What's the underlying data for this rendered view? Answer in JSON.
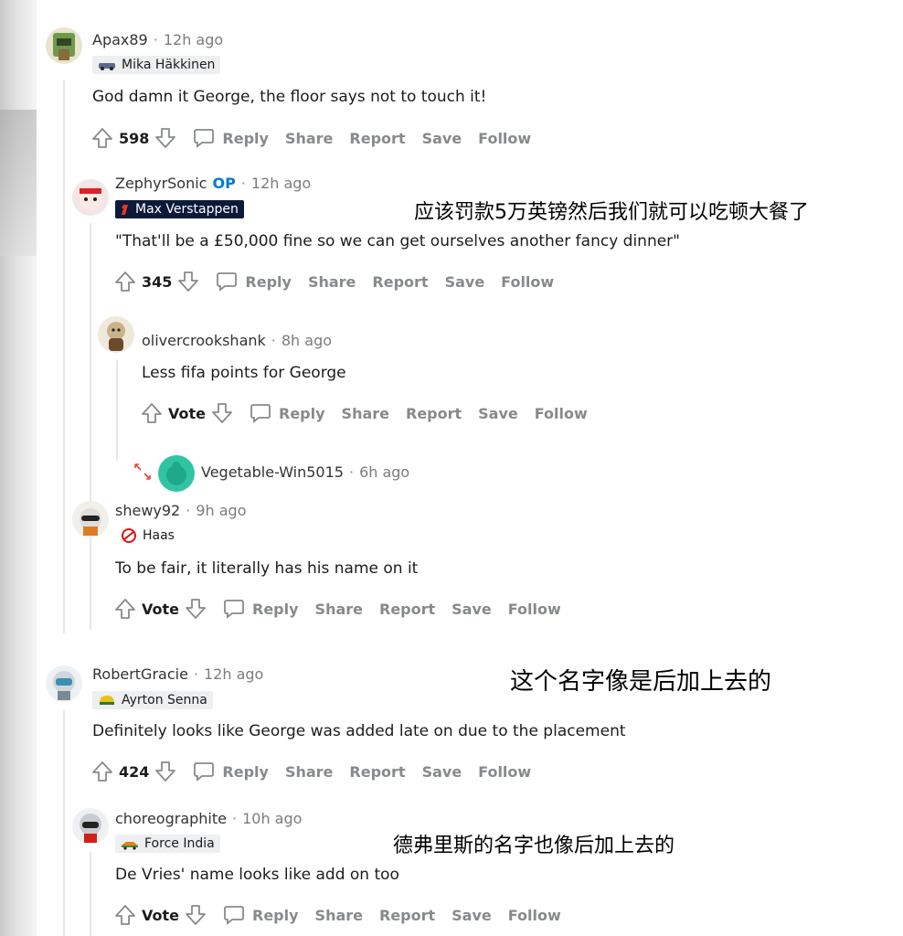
{
  "comments": [
    {
      "username": "Apax89",
      "op": "",
      "time": "12h ago",
      "flair": "Mika Häkkinen",
      "body": "God damn it George, the floor says not to touch it!",
      "score": "598"
    },
    {
      "username": "ZephyrSonic",
      "op": "OP",
      "time": "12h ago",
      "flair": "Max Verstappen",
      "body": "\"That'll be a £50,000 fine so we can get ourselves another fancy dinner\"",
      "score": "345"
    },
    {
      "username": "olivercrookshank",
      "op": "",
      "time": "8h ago",
      "flair": "",
      "body": "Less fifa points for George",
      "score": "Vote"
    },
    {
      "username": "Vegetable-Win5015",
      "op": "",
      "time": "6h ago",
      "flair": "",
      "body": "",
      "score": ""
    },
    {
      "username": "shewy92",
      "op": "",
      "time": "9h ago",
      "flair": "Haas",
      "body": "To be fair, it literally has his name on it",
      "score": "Vote"
    },
    {
      "username": "RobertGracie",
      "op": "",
      "time": "12h ago",
      "flair": "Ayrton Senna",
      "body": "Definitely looks like George was added late on due to the placement",
      "score": "424"
    },
    {
      "username": "choreographite",
      "op": "",
      "time": "10h ago",
      "flair": "Force India",
      "body": "De Vries' name looks like add on too",
      "score": "Vote"
    }
  ],
  "actions": {
    "reply": "Reply",
    "share": "Share",
    "report": "Report",
    "save": "Save",
    "follow": "Follow"
  },
  "separator": "·",
  "annotations": {
    "a1": "应该罚款5万英镑然后我们就可以吃顿大餐了",
    "a2": "这个名字像是后加上去的",
    "a3": "德弗里斯的名字也像后加上去的"
  },
  "colors": {
    "op_blue": "#0079d3",
    "flair_dark": "#0b1a3a",
    "action_gray": "#878a8c"
  }
}
